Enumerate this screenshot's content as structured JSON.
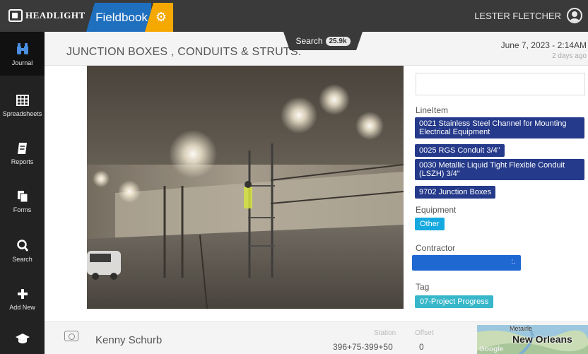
{
  "header": {
    "logo_text": "HEADLIGHT",
    "app_tab": "Fieldbook",
    "user_name": "LESTER FLETCHER"
  },
  "sidebar": {
    "items": [
      {
        "label": "Journal",
        "icon": "binoculars-icon",
        "glyph": "∷"
      },
      {
        "label": "Spreadsheets",
        "icon": "grid-icon",
        "glyph": "▦"
      },
      {
        "label": "Reports",
        "icon": "report-icon",
        "glyph": "▤"
      },
      {
        "label": "Forms",
        "icon": "forms-icon",
        "glyph": "▣"
      },
      {
        "label": "Search",
        "icon": "search-icon",
        "glyph": "⌕"
      },
      {
        "label": "Add New",
        "icon": "plus-icon",
        "glyph": "+"
      },
      {
        "label": "",
        "icon": "graduation-cap-icon",
        "glyph": "▲"
      }
    ]
  },
  "entry": {
    "title": "JUNCTION BOXES , CONDUITS & STRUTS.",
    "search_label": "Search",
    "search_count": "25.9k",
    "date": "June 7, 2023 - 2:14AM",
    "ago": "2 days ago"
  },
  "details": {
    "lineitem_label": "LineItem",
    "lineitems": [
      "0021 Stainless Steel Channel for Mounting Electrical Equipment",
      "0025 RGS Conduit 3/4\"",
      "0030 Metallic Liquid Tight Flexible Conduit (LSZH) 3/4\"",
      "9702 Junction Boxes"
    ],
    "equipment_label": "Equipment",
    "equipment": "Other",
    "contractor_label": "Contractor",
    "contractor_dots": ":.",
    "tag_label": "Tag",
    "tag": "07-Project Progress"
  },
  "footer_row": {
    "author": "Kenny Schurb",
    "station_label": "Station",
    "station_value": "396+75-399+50",
    "offset_label": "Offset",
    "offset_value": "0",
    "map_city": "New Orleans",
    "map_town": "Metairie",
    "map_brand": "Google"
  },
  "colors": {
    "header_bg": "#3a3a3a",
    "fieldbook_blue": "#1f6fbf",
    "gear_orange": "#f5a800",
    "sidebar_bg": "#222222",
    "lineitem_navy": "#253a8a",
    "equipment_cyan": "#15a9e0",
    "tag_teal": "#37b7c9",
    "contractor_blue": "#1f68d2"
  }
}
